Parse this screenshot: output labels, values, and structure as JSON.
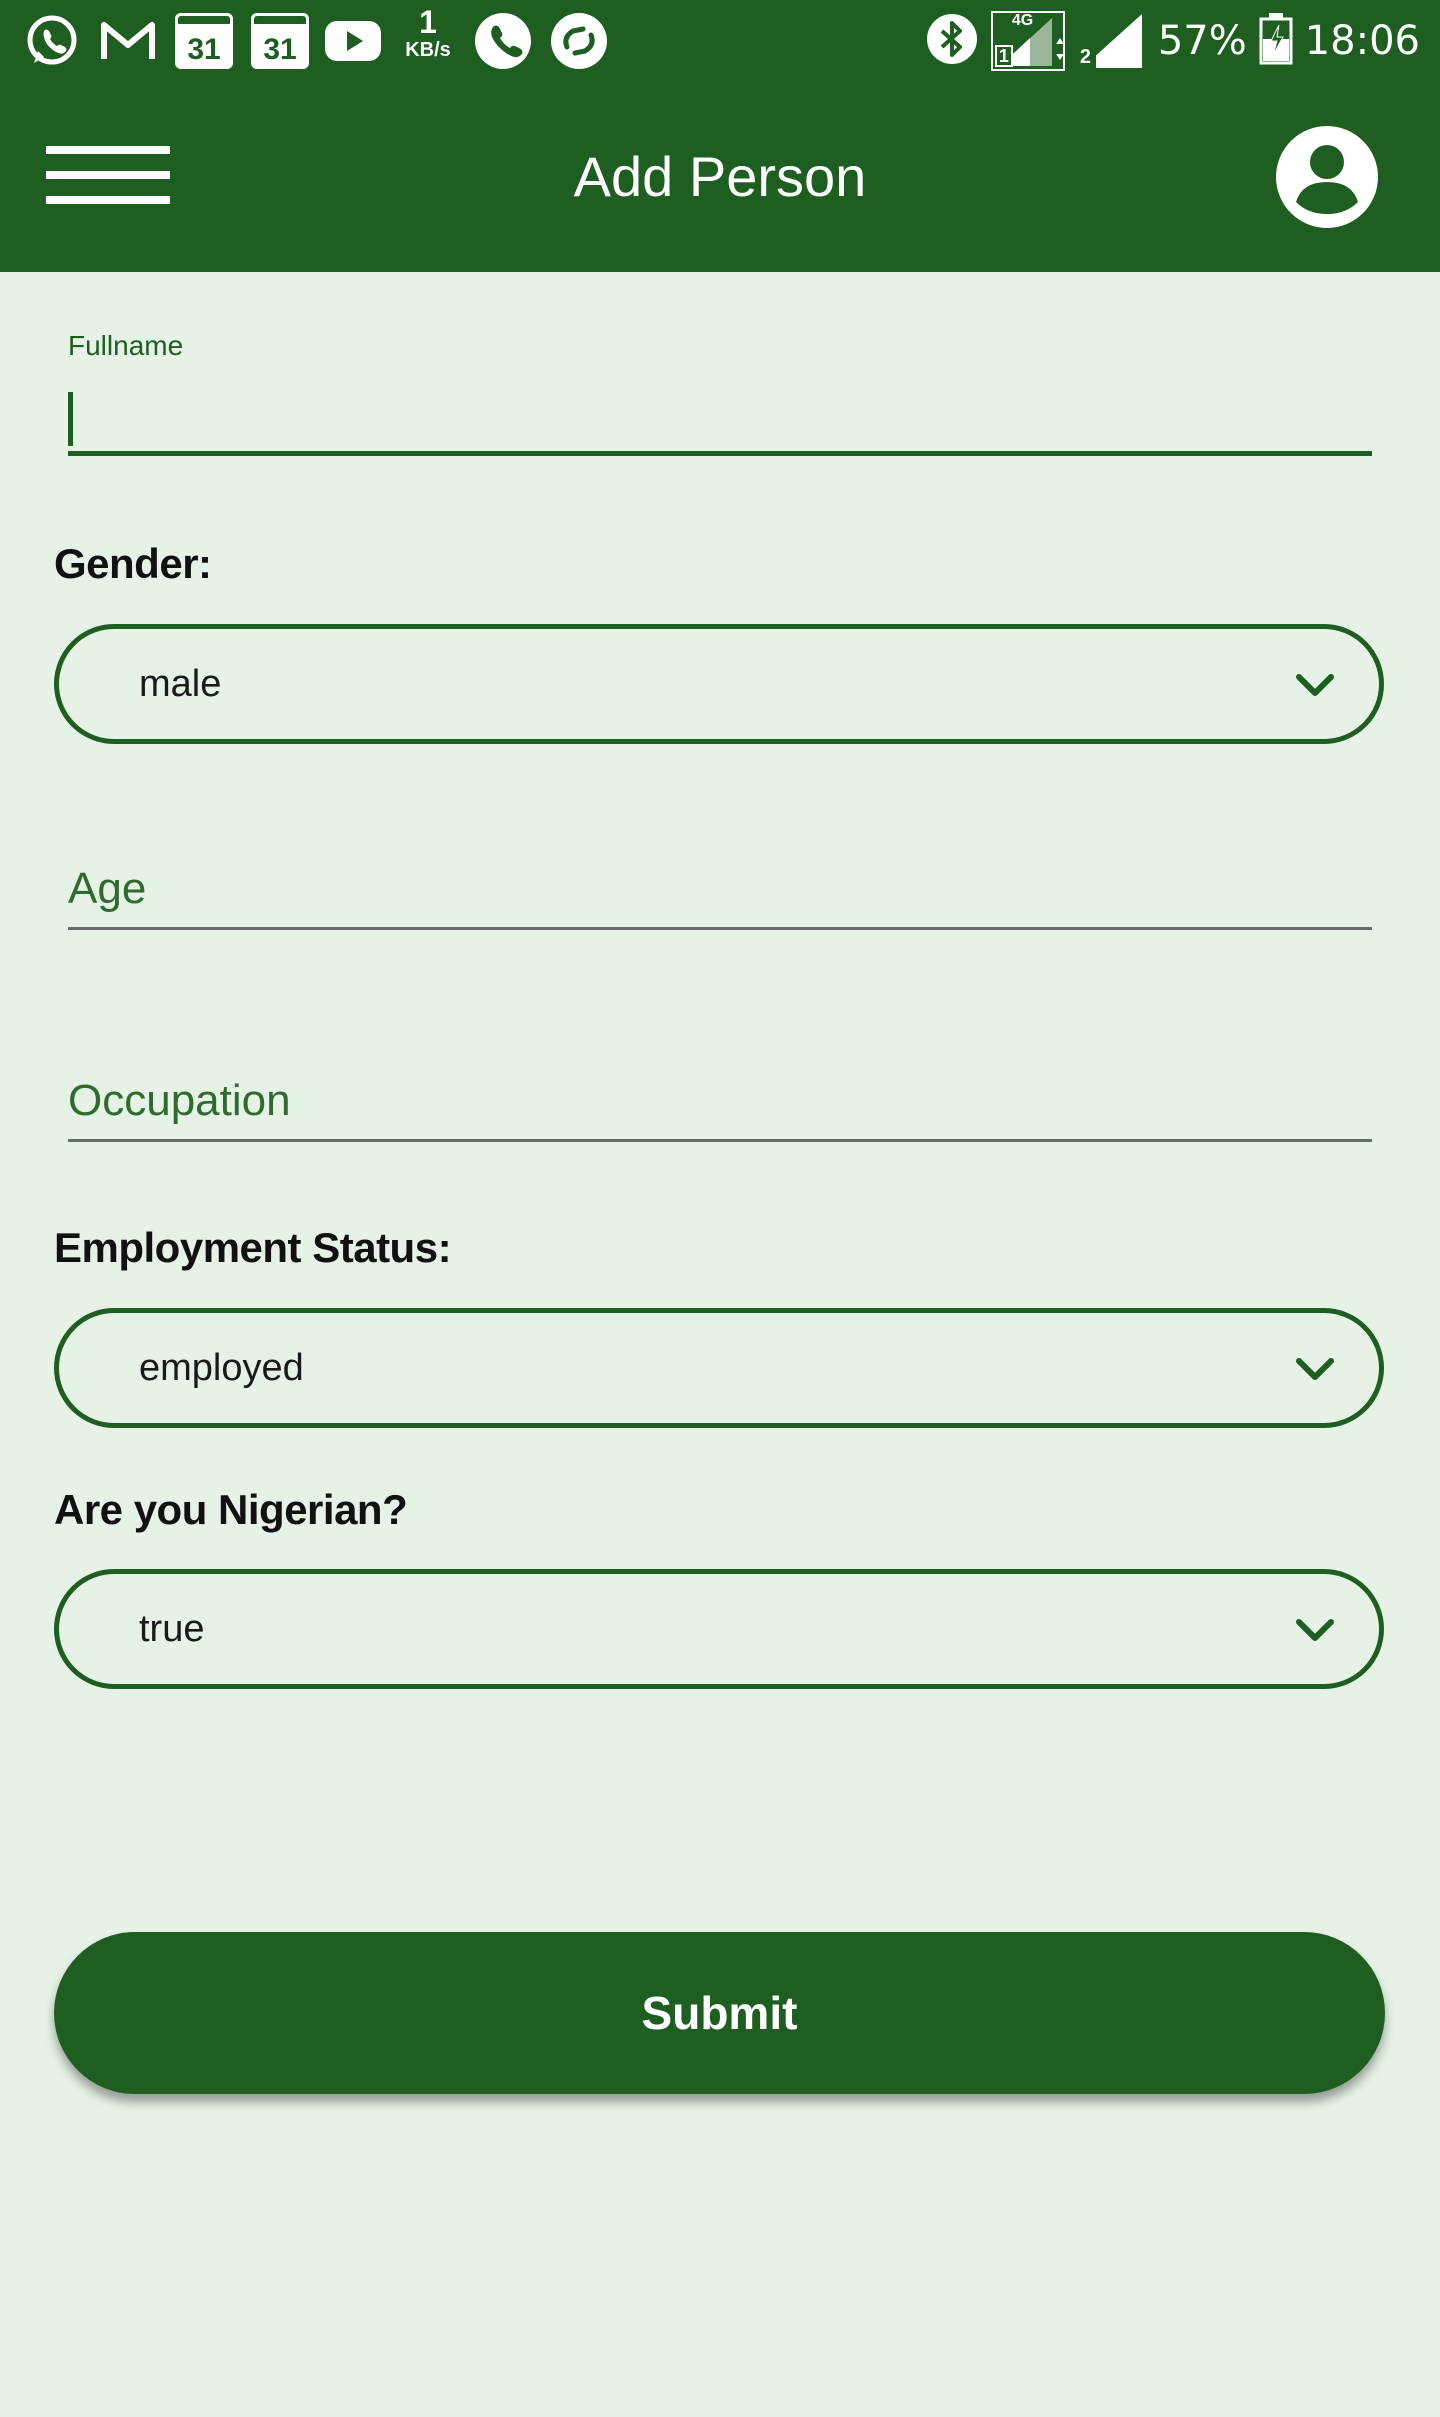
{
  "status_bar": {
    "calendar_day_1": "31",
    "calendar_day_2": "31",
    "net_speed_value": "1",
    "net_speed_unit": "KB/s",
    "network_type": "4G",
    "sim1": "1",
    "sim2": "2",
    "battery": "57%",
    "time": "18:06"
  },
  "app_bar": {
    "title": "Add Person",
    "menu_icon": "hamburger-menu-icon",
    "account_icon": "account-circle-icon"
  },
  "form": {
    "fullname": {
      "label": "Fullname",
      "value": ""
    },
    "gender": {
      "label": "Gender:",
      "selected": "male"
    },
    "age": {
      "placeholder": "Age",
      "value": ""
    },
    "occupation": {
      "placeholder": "Occupation",
      "value": ""
    },
    "employment_status": {
      "label": "Employment Status:",
      "selected": "employed"
    },
    "nigerian": {
      "label": "Are you Nigerian?",
      "selected": "true"
    },
    "submit_label": "Submit"
  },
  "colors": {
    "primary": "#1e5e20",
    "background": "#e6f2e6",
    "accent_text": "#2f6b2f"
  }
}
